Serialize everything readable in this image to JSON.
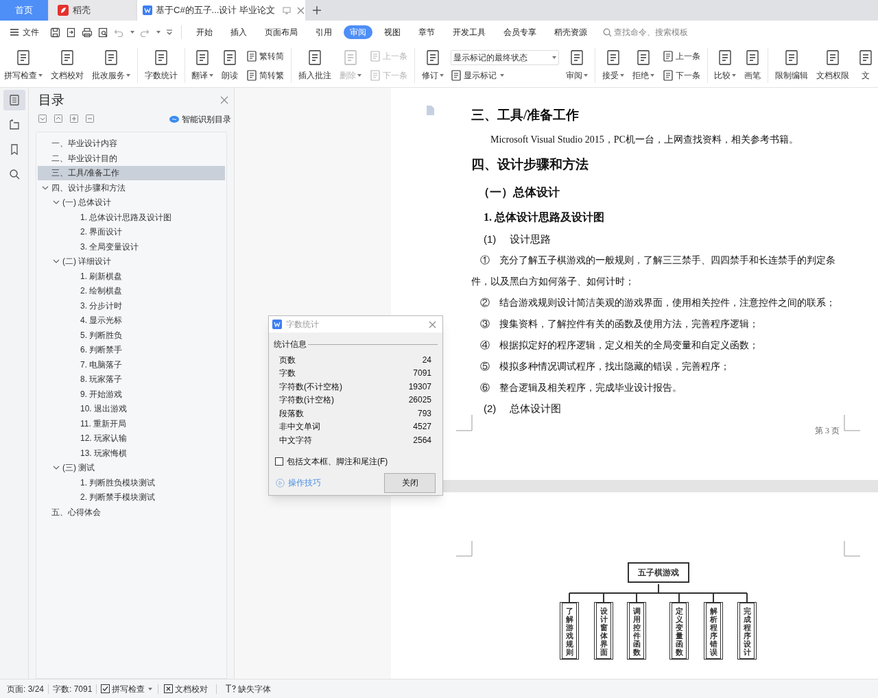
{
  "title_tabs": [
    {
      "kind": "home",
      "label": "首页",
      "selected": false
    },
    {
      "kind": "app",
      "label": "稻壳",
      "selected": false
    },
    {
      "kind": "document",
      "label": "基于C#的五子...设计 毕业论文",
      "selected": true
    }
  ],
  "menu": {
    "file_label": "文件",
    "tabs": [
      {
        "label": "开始",
        "selected": false
      },
      {
        "label": "插入",
        "selected": false
      },
      {
        "label": "页面布局",
        "selected": false
      },
      {
        "label": "引用",
        "selected": false
      },
      {
        "label": "审阅",
        "selected": true
      },
      {
        "label": "视图",
        "selected": false
      },
      {
        "label": "章节",
        "selected": false
      },
      {
        "label": "开发工具",
        "selected": false
      },
      {
        "label": "会员专享",
        "selected": false
      },
      {
        "label": "稻壳资源",
        "selected": false
      }
    ],
    "search": {
      "placeholder": "查找命令、搜索模板"
    }
  },
  "ribbon": [
    {
      "kind": "large",
      "label": "拼写检查",
      "dropdown": true,
      "disabled": false
    },
    {
      "kind": "large",
      "label": "文档校对",
      "dropdown": false,
      "disabled": false
    },
    {
      "kind": "large",
      "label": "批改服务",
      "dropdown": true,
      "disabled": false
    },
    {
      "kind": "separator"
    },
    {
      "kind": "large",
      "label": "字数统计",
      "dropdown": false,
      "disabled": false
    },
    {
      "kind": "separator"
    },
    {
      "kind": "large",
      "label": "翻译",
      "dropdown": true,
      "disabled": false
    },
    {
      "kind": "large",
      "label": "朗读",
      "dropdown": false,
      "disabled": false
    },
    {
      "kind": "stack",
      "entries": [
        {
          "label": "繁转简",
          "dropdown": false,
          "disabled": false
        },
        {
          "label": "简转繁",
          "dropdown": false,
          "disabled": false
        }
      ]
    },
    {
      "kind": "separator"
    },
    {
      "kind": "large",
      "label": "插入批注",
      "dropdown": false,
      "disabled": false
    },
    {
      "kind": "large",
      "label": "删除",
      "dropdown": true,
      "disabled": true
    },
    {
      "kind": "stack",
      "entries": [
        {
          "label": "上一条",
          "dropdown": false,
          "disabled": true
        },
        {
          "label": "下一条",
          "dropdown": false,
          "disabled": true
        }
      ]
    },
    {
      "kind": "separator"
    },
    {
      "kind": "large",
      "label": "修订",
      "dropdown": true,
      "disabled": false
    },
    {
      "kind": "select_stack",
      "value": "显示标记的最终状态",
      "entry": {
        "label": "显示标记",
        "dropdown": true,
        "disabled": false
      }
    },
    {
      "kind": "large",
      "label": "审阅",
      "dropdown": true,
      "disabled": false
    },
    {
      "kind": "separator"
    },
    {
      "kind": "large",
      "label": "接受",
      "dropdown": true,
      "disabled": false
    },
    {
      "kind": "large",
      "label": "拒绝",
      "dropdown": true,
      "disabled": false
    },
    {
      "kind": "stack",
      "entries": [
        {
          "label": "上一条",
          "dropdown": false,
          "disabled": false
        },
        {
          "label": "下一条",
          "dropdown": false,
          "disabled": false
        }
      ]
    },
    {
      "kind": "separator"
    },
    {
      "kind": "large",
      "label": "比较",
      "dropdown": true,
      "disabled": false
    },
    {
      "kind": "large",
      "label": "画笔",
      "dropdown": false,
      "disabled": false
    },
    {
      "kind": "separator"
    },
    {
      "kind": "large",
      "label": "限制编辑",
      "dropdown": false,
      "disabled": false
    },
    {
      "kind": "large",
      "label": "文档权限",
      "dropdown": false,
      "disabled": false
    },
    {
      "kind": "large",
      "label": "文",
      "dropdown": false,
      "disabled": false
    }
  ],
  "nav_rail": [
    {
      "selected": true
    },
    {
      "selected": false
    },
    {
      "selected": false
    },
    {
      "selected": false
    }
  ],
  "toc": {
    "title": "目录",
    "smart_label": "智能识别目录",
    "items": [
      {
        "label": "一、毕业设计内容",
        "selected": false
      },
      {
        "label": "二、毕业设计目的",
        "selected": false
      },
      {
        "label": "三、工具/准备工作",
        "selected": true
      },
      {
        "label": "四、设计步骤和方法",
        "selected": false,
        "expanded": true,
        "children": [
          {
            "label": "(一) 总体设计",
            "selected": false,
            "expanded": true,
            "children": [
              {
                "label": "1. 总体设计思路及设计图",
                "selected": false
              },
              {
                "label": "2. 界面设计",
                "selected": false
              },
              {
                "label": "3. 全局变量设计",
                "selected": false
              }
            ]
          },
          {
            "label": "(二) 详细设计",
            "selected": false,
            "expanded": true,
            "children": [
              {
                "label": "1. 刷新棋盘",
                "selected": false
              },
              {
                "label": "2. 绘制棋盘",
                "selected": false
              },
              {
                "label": "3. 分步计时",
                "selected": false
              },
              {
                "label": "4. 显示光标",
                "selected": false
              },
              {
                "label": "5. 判断胜负",
                "selected": false
              },
              {
                "label": "6. 判断禁手",
                "selected": false
              },
              {
                "label": "7. 电脑落子",
                "selected": false
              },
              {
                "label": "8. 玩家落子",
                "selected": false
              },
              {
                "label": "9. 开始游戏",
                "selected": false
              },
              {
                "label": "10. 退出游戏",
                "selected": false
              },
              {
                "label": "11. 重新开局",
                "selected": false
              },
              {
                "label": "12. 玩家认输",
                "selected": false
              },
              {
                "label": "13. 玩家悔棋",
                "selected": false
              }
            ]
          },
          {
            "label": "(三) 测试",
            "selected": false,
            "expanded": true,
            "children": [
              {
                "label": "1. 判断胜负模块测试",
                "selected": false
              },
              {
                "label": "2. 判断禁手模块测试",
                "selected": false
              }
            ]
          }
        ]
      },
      {
        "label": "五、心得体会",
        "selected": false
      }
    ]
  },
  "document": {
    "page_number": "第 3 页",
    "paragraphs": [
      {
        "kind": "heading1",
        "text": "三、工具/准备工作"
      },
      {
        "kind": "body",
        "text": "Microsoft Visual Studio 2015，PC机一台，上网查找资料，相关参考书籍。"
      },
      {
        "kind": "heading1",
        "text": "四、设计步骤和方法"
      },
      {
        "kind": "heading2",
        "text": "（一）总体设计"
      },
      {
        "kind": "heading3",
        "text": "1. 总体设计思路及设计图"
      },
      {
        "kind": "numbered",
        "text": "(1)　 设计思路"
      },
      {
        "kind": "item",
        "text": "①　充分了解五子棋游戏的一般规则，了解三三禁手、四四禁手和长连禁手的判定条件，以及黑白方如何落子、如何计时；"
      },
      {
        "kind": "item",
        "text": "②　结合游戏规则设计简洁美观的游戏界面，使用相关控件，注意控件之间的联系；"
      },
      {
        "kind": "item",
        "text": "③　搜集资料，了解控件有关的函数及使用方法，完善程序逻辑；"
      },
      {
        "kind": "item",
        "text": "④　根据拟定好的程序逻辑，定义相关的全局变量和自定义函数；"
      },
      {
        "kind": "item",
        "text": "⑤　模拟多种情况调试程序，找出隐藏的错误，完善程序；"
      },
      {
        "kind": "item",
        "text": "⑥　整合逻辑及相关程序，完成毕业设计报告。"
      },
      {
        "kind": "numbered",
        "text": "(2)　 总体设计图"
      }
    ],
    "diagram": {
      "root": "五子棋游戏",
      "children": [
        "了解游戏规则",
        "设计窗体界面",
        "调用控件函数",
        "定义变量函数",
        "解析程序错误",
        "完成程序设计"
      ]
    }
  },
  "dialog": {
    "title": "字数统计",
    "section": "统计信息",
    "rows": [
      {
        "label": "页数",
        "value": "24"
      },
      {
        "label": "字数",
        "value": "7091"
      },
      {
        "label": "字符数(不计空格)",
        "value": "19307"
      },
      {
        "label": "字符数(计空格)",
        "value": "26025"
      },
      {
        "label": "段落数",
        "value": "793"
      },
      {
        "label": "非中文单词",
        "value": "4527"
      },
      {
        "label": "中文字符",
        "value": "2564"
      }
    ],
    "checkbox": {
      "label": "包括文本框、脚注和尾注(F)",
      "checked": false
    },
    "link": "操作技巧",
    "button": "关闭"
  },
  "status_bar": {
    "page": "页面: 3/24",
    "words": "字数: 7091",
    "spell": "拼写检查",
    "proof": "文档校对",
    "font": "缺失字体"
  }
}
